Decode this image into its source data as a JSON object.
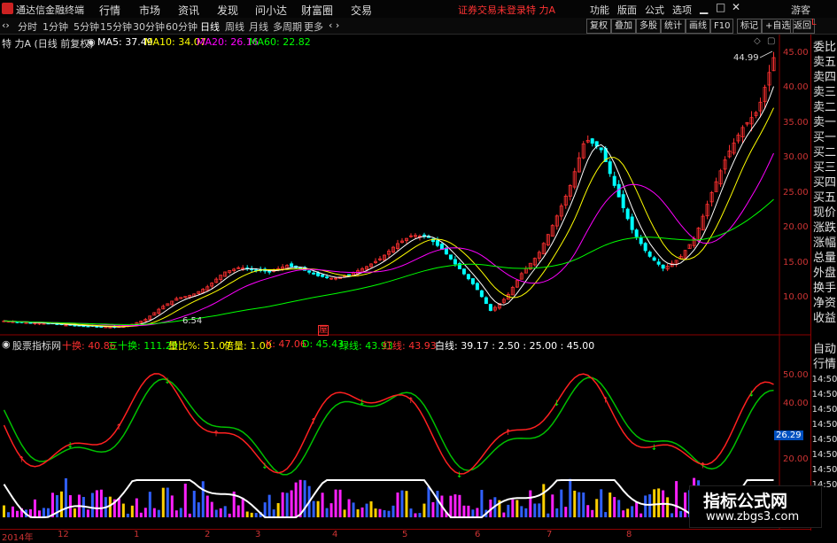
{
  "app": {
    "brand": "通达信金融终端",
    "login_status": "证券交易未登录",
    "stock": "特 力A"
  },
  "menu": [
    "行情",
    "市场",
    "资讯",
    "发现",
    "问小达",
    "财富圈",
    "交易"
  ],
  "right_menu": [
    "功能",
    "版面",
    "公式",
    "选项"
  ],
  "guest": "游客",
  "periods": [
    "分时",
    "1分钟",
    "5分钟",
    "15分钟",
    "30分钟",
    "60分钟",
    "日线",
    "周线",
    "月线",
    "多周期",
    "更多"
  ],
  "active_period": "日线",
  "right_tools": [
    "复权",
    "叠加",
    "多股",
    "统计",
    "画线",
    "F10",
    "标记",
    "+自选",
    "返回"
  ],
  "main_info": {
    "title": "特 力A (日线 前复权)",
    "ma5": "MA5: 37.49",
    "ma10": "MA10: 34.07",
    "ma20": "MA20: 26.16",
    "ma60": "MA60: 22.82"
  },
  "price_axis": [
    "45.00",
    "40.00",
    "35.00",
    "30.00",
    "25.00",
    "20.00",
    "15.00",
    "10.00"
  ],
  "high_label": "44.99",
  "low_label": "6.54",
  "ind_info": {
    "name": "股票指标网",
    "v1": "十换: 40.86",
    "v2": "三十换: 111.29",
    "v3": "量比%: 51.07",
    "v4": "倍量: 1.00",
    "v5": "K: 47.06",
    "v6": "D: 45.43",
    "v7": "绿线: 43.93",
    "v8": "红线: 43.93",
    "v9": "白线: 39.17 : 2.50 : 25.00 : 45.00"
  },
  "ind_axis": [
    "50.00",
    "40.00",
    "20.00"
  ],
  "ind_cursor": "26.29",
  "side_panel": [
    "委比",
    "卖五",
    "卖四",
    "卖三",
    "卖二",
    "卖一",
    "买一",
    "买二",
    "买三",
    "买四",
    "买五",
    "现价",
    "涨跌",
    "涨幅",
    "总量",
    "外盘",
    "换手",
    "净资",
    "收益"
  ],
  "side_bottom": [
    "自动",
    "行情",
    "14:50",
    "14:50",
    "14:50",
    "14:50",
    "14:50",
    "14:50",
    "14:50",
    "14:50"
  ],
  "time_axis": [
    "2014年",
    "12",
    "1",
    "2",
    "3",
    "4",
    "5",
    "6",
    "7",
    "8"
  ],
  "watermark": {
    "line1": "指标公式网",
    "line2": "www.zbgs3.com"
  },
  "colors": {
    "up": "#ff3030",
    "down": "#00ffff",
    "ma5": "#ffffff",
    "ma10": "#ffff00",
    "ma20": "#ff00ff",
    "ma60": "#00ff00",
    "axis": "#cc3333"
  },
  "chart_data": {
    "type": "candlestick",
    "title": "特 力A (日线 前复权)",
    "ylim": [
      6.0,
      46.0
    ],
    "close_path": [
      7.6,
      7.4,
      7.3,
      7.2,
      7.0,
      6.9,
      6.8,
      6.7,
      7.0,
      7.8,
      9.5,
      10.8,
      11.3,
      12.5,
      14.5,
      15.2,
      14.8,
      14.6,
      15.5,
      14.9,
      14.0,
      13.6,
      14.2,
      15.2,
      16.5,
      18.5,
      19.8,
      19.5,
      17.5,
      15.0,
      12.5,
      9.0,
      11.0,
      14.5,
      17.0,
      21.5,
      26.5,
      33.5,
      32.0,
      26.0,
      20.5,
      17.0,
      15.0,
      16.5,
      19.5,
      25.5,
      31.0,
      35.0,
      37.5,
      44.99
    ]
  }
}
